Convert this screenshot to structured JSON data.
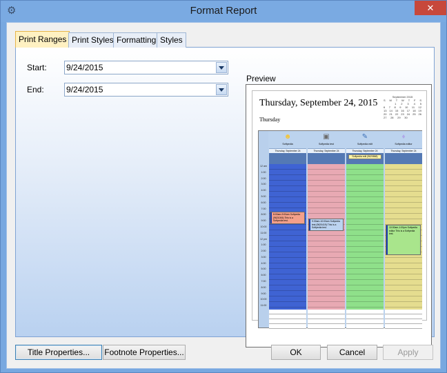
{
  "window": {
    "title": "Format Report",
    "close_glyph": "✕",
    "app_icon": "gear-icon"
  },
  "tabs": [
    {
      "label": "Print Ranges",
      "active": true
    },
    {
      "label": "Print Styles",
      "active": false
    },
    {
      "label": "Formatting",
      "active": false
    },
    {
      "label": "Styles",
      "active": false
    }
  ],
  "print_ranges": {
    "start_label": "Start:",
    "start_value": "9/24/2015",
    "end_label": "End:",
    "end_value": "9/24/2015"
  },
  "preview": {
    "label": "Preview",
    "date_heading": "Thursday, September 24, 2015",
    "day_label": "Thursday",
    "mini_calendar": {
      "title": "September 2015",
      "weekdays": [
        "S",
        "M",
        "T",
        "W",
        "T",
        "F",
        "S"
      ]
    },
    "times": [
      "12 am",
      "1:00",
      "2:00",
      "3:00",
      "4:00",
      "5:00",
      "6:00",
      "7:00",
      "8:00",
      "9:00",
      "10:00",
      "11:00",
      "12 pm",
      "1:00",
      "2:00",
      "3:00",
      "4:00",
      "5:00",
      "6:00",
      "7:00",
      "8:00",
      "9:00",
      "10:00",
      "11:00"
    ],
    "resources": [
      {
        "name": "Softpedia",
        "date": "Thursday, September 24",
        "icon": "person-icon",
        "color": "#3f63d3",
        "icon_color": "#f2c53d"
      },
      {
        "name": "Softpedia test",
        "date": "Thursday, September 24",
        "icon": "robot-icon",
        "color": "#e8a9b3",
        "icon_color": "#6c6c6c"
      },
      {
        "name": "Softpedia edit",
        "date": "Thursday, September 24",
        "icon": "edit-icon",
        "color": "#8fe08a",
        "icon_color": "#3b6fb6"
      },
      {
        "name": "Softpedia editor",
        "date": "Thursday, September 24",
        "icon": "bulb-icon",
        "color": "#e5dd8f",
        "icon_color": "#b0a8e8"
      }
    ],
    "appointments": [
      {
        "res": 0,
        "text": "8:00am-9:00am Softpedia (9621006) This is a Softpedia test.",
        "color": "#f4a08a"
      },
      {
        "res": 1,
        "text": "9:30am-10:00am Softpedia test (9620419) This is a Softpedia test.",
        "color": "#bcd3f0"
      },
      {
        "res": 3,
        "text": "10:00am-1:00pm Softpedia editor This is a Softpedia test.",
        "color": "#a9e58c"
      }
    ],
    "allday_event": "Softpedia edit (9620868)"
  },
  "buttons": {
    "title_properties": "Title Properties...",
    "footnote_properties": "Footnote Properties...",
    "ok": "OK",
    "cancel": "Cancel",
    "apply": "Apply"
  }
}
